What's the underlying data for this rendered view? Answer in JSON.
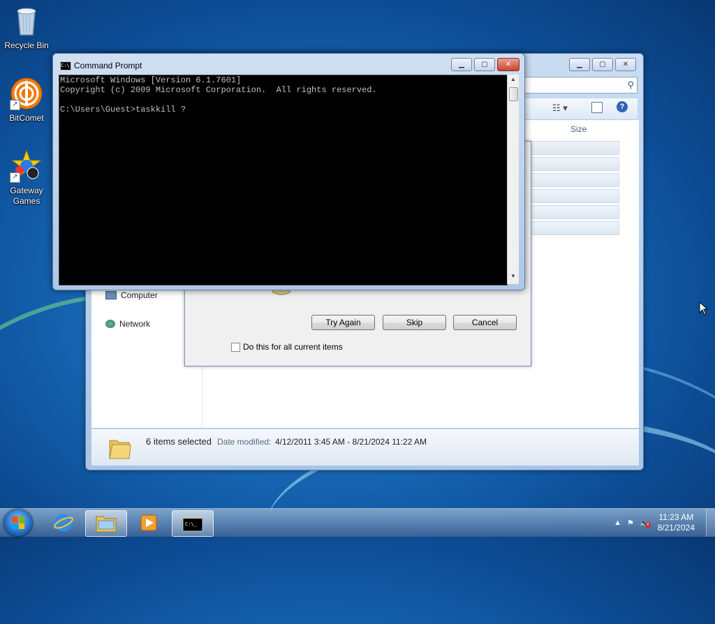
{
  "desktop": {
    "icons": [
      {
        "label": "Recycle Bin"
      },
      {
        "label": "BitComet"
      },
      {
        "label": "Gateway Games"
      }
    ]
  },
  "explorer": {
    "nav": {
      "computer": "Computer",
      "network": "Network"
    },
    "column_size": "Size",
    "details": {
      "count": "6 items selected",
      "date_label": "Date modified:",
      "date_range": "4/12/2011 3:45 AM - 8/21/2024 11:22 AM"
    }
  },
  "dialog": {
    "try_again": "Try Again",
    "skip": "Skip",
    "cancel": "Cancel",
    "checkbox_label": "Do this for all current items"
  },
  "cmd": {
    "title": "Command Prompt",
    "icon_text": "C:\\",
    "lines": [
      "Microsoft Windows [Version 6.1.7601]",
      "Copyright (c) 2009 Microsoft Corporation.  All rights reserved.",
      "",
      "C:\\Users\\Guest>taskkill ?"
    ]
  },
  "taskbar": {
    "time": "11:23 AM",
    "date": "8/21/2024"
  }
}
